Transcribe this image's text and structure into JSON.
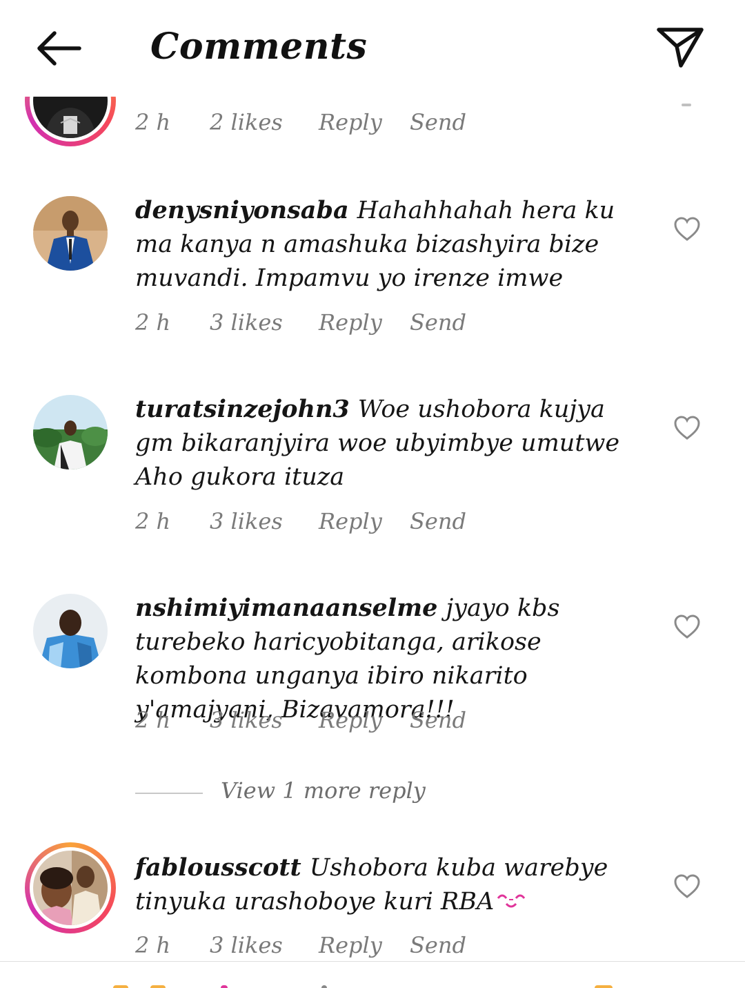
{
  "header": {
    "title": "Comments"
  },
  "comments": [
    {
      "username": "",
      "text": "",
      "time": "2 h",
      "likes": "2 likes",
      "reply": "Reply",
      "send": "Send",
      "avatar_ring": true
    },
    {
      "username": "denysniyonsaba",
      "text": "Hahahhahah hera ku ma kanya n amashuka bizashyira bize muvandi. Impamvu yo irenze imwe",
      "time": "2 h",
      "likes": "3 likes",
      "reply": "Reply",
      "send": "Send",
      "avatar_ring": false
    },
    {
      "username": "turatsinzejohn3",
      "text": "Woe ushobora kujya gm bikaranjyira woe ubyimbye umutwe Aho gukora ituza",
      "time": "2 h",
      "likes": "3 likes",
      "reply": "Reply",
      "send": "Send",
      "avatar_ring": false
    },
    {
      "username": "nshimiyimanaanselme",
      "text": "jyayo kbs turebeko haricyobitanga, arikose kombona unganya ibiro nikarito y'amajyani, Bizavamora!!!",
      "time": "2 h",
      "likes": "3 likes",
      "reply": "Reply",
      "send": "Send",
      "avatar_ring": false
    },
    {
      "username": "fablousscott",
      "text": "Ushobora kuba warebye tinyuka urashoboye kuri RBA",
      "time": "2 h",
      "likes": "3 likes",
      "reply": "Reply",
      "send": "Send",
      "avatar_ring": true
    }
  ],
  "view_more": "View 1 more reply",
  "icons": {
    "back": "arrow-left-icon",
    "direct": "paper-plane-icon",
    "like": "heart-outline-icon",
    "emoji": "kissing-face-emoji"
  },
  "colors": {
    "text": "#151515",
    "meta": "#7a7a7a",
    "ring_start": "#f9a23a",
    "ring_mid": "#f5475b",
    "ring_end": "#d22fb0",
    "emoji_pink": "#e0359a"
  }
}
